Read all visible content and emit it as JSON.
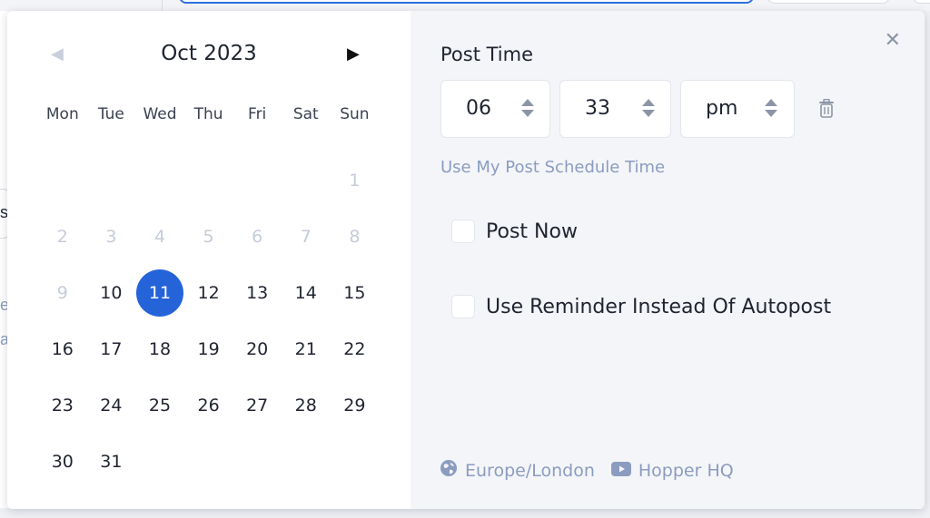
{
  "background": {
    "edge_texts": [
      "s",
      "e",
      "a"
    ]
  },
  "calendar": {
    "month_title": "Oct 2023",
    "prev_icon": "triangle-left-icon",
    "next_icon": "triangle-right-icon",
    "weekdays": [
      "Mon",
      "Tue",
      "Wed",
      "Thu",
      "Fri",
      "Sat",
      "Sun"
    ],
    "weeks": [
      [
        {
          "t": ""
        },
        {
          "t": ""
        },
        {
          "t": ""
        },
        {
          "t": ""
        },
        {
          "t": ""
        },
        {
          "t": ""
        },
        {
          "t": "1",
          "s": "other"
        }
      ],
      [
        {
          "t": "2",
          "s": "other"
        },
        {
          "t": "3",
          "s": "other"
        },
        {
          "t": "4",
          "s": "other"
        },
        {
          "t": "5",
          "s": "other"
        },
        {
          "t": "6",
          "s": "other"
        },
        {
          "t": "7",
          "s": "other"
        },
        {
          "t": "8",
          "s": "other"
        }
      ],
      [
        {
          "t": "9",
          "s": "other"
        },
        {
          "t": "10"
        },
        {
          "t": "11",
          "s": "selected"
        },
        {
          "t": "12"
        },
        {
          "t": "13"
        },
        {
          "t": "14"
        },
        {
          "t": "15"
        }
      ],
      [
        {
          "t": "16"
        },
        {
          "t": "17"
        },
        {
          "t": "18"
        },
        {
          "t": "19"
        },
        {
          "t": "20"
        },
        {
          "t": "21"
        },
        {
          "t": "22"
        }
      ],
      [
        {
          "t": "23"
        },
        {
          "t": "24"
        },
        {
          "t": "25"
        },
        {
          "t": "26"
        },
        {
          "t": "27"
        },
        {
          "t": "28"
        },
        {
          "t": "29"
        }
      ],
      [
        {
          "t": "30"
        },
        {
          "t": "31"
        },
        {
          "t": ""
        },
        {
          "t": ""
        },
        {
          "t": ""
        },
        {
          "t": ""
        },
        {
          "t": ""
        }
      ]
    ],
    "selected_color": "#2563d8",
    "disabled_color": "#c5ccd8"
  },
  "post_time": {
    "label": "Post Time",
    "hour": "06",
    "minute": "33",
    "ampm": "pm",
    "close_icon": "close-icon",
    "trash_icon": "trash-icon",
    "schedule_link": "Use My Post Schedule Time",
    "options": [
      {
        "label": "Post Now",
        "checked": false
      },
      {
        "label": "Use Reminder Instead Of Autopost",
        "checked": false
      }
    ],
    "timezone": "Europe/London",
    "account": "Hopper HQ",
    "link_color": "#8b9cc0"
  }
}
